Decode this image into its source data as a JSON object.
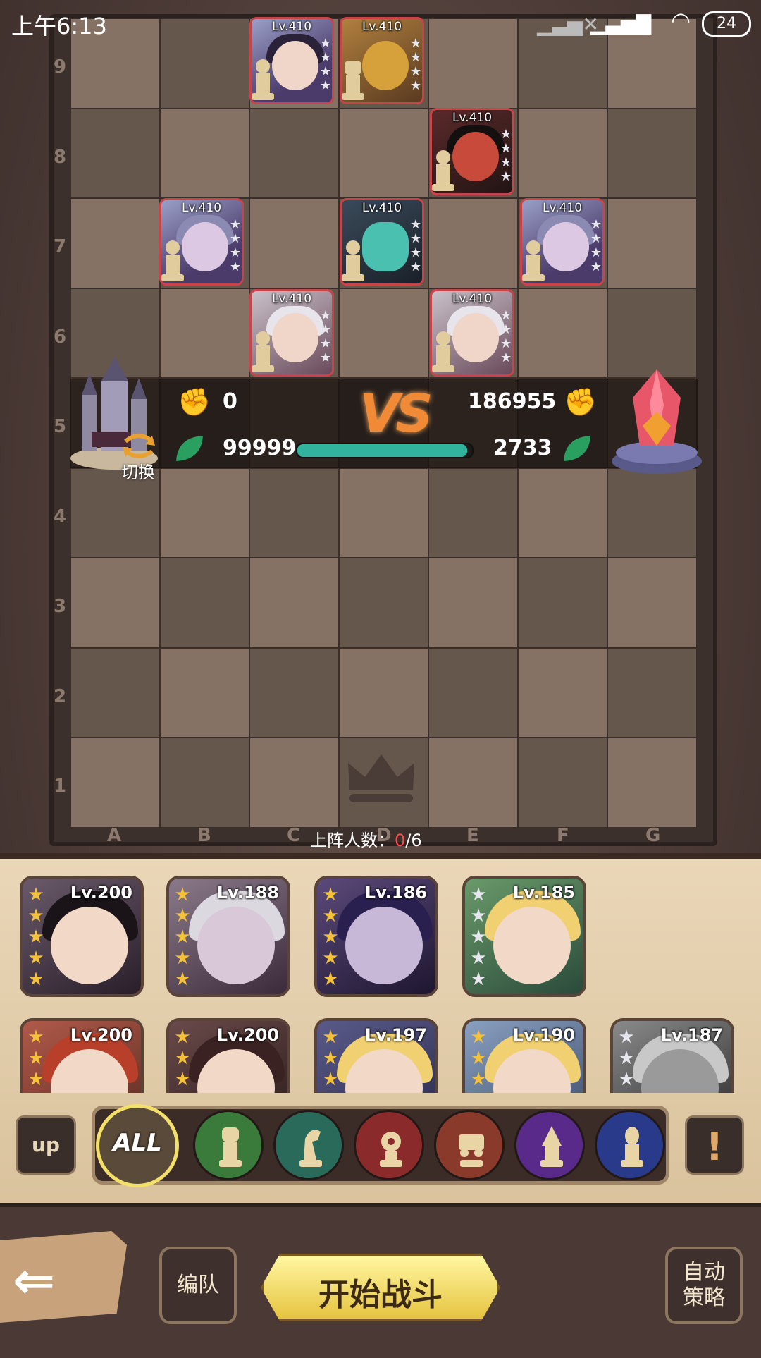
{
  "status_bar": {
    "time": "上午6:13",
    "battery": "24"
  },
  "board": {
    "ranks": [
      "9",
      "8",
      "7",
      "6",
      "5",
      "4",
      "3",
      "2",
      "1"
    ],
    "files": [
      "A",
      "B",
      "C",
      "D",
      "E",
      "F",
      "G"
    ]
  },
  "enemy_units": [
    {
      "level": "Lv.410"
    },
    {
      "level": "Lv.410"
    },
    {
      "level": "Lv.410"
    },
    {
      "level": "Lv.410"
    },
    {
      "level": "Lv.410"
    },
    {
      "level": "Lv.410"
    },
    {
      "level": "Lv.410"
    },
    {
      "level": "Lv.410"
    }
  ],
  "versus": {
    "vs_label": "VS",
    "player_attack": "0",
    "player_power": "99999",
    "enemy_attack": "186955",
    "enemy_power": "2733",
    "switch_label": "切换",
    "hp_fraction": 0.97
  },
  "deploy": {
    "label": "上阵人数：",
    "current": "0",
    "max": "/6"
  },
  "heroes": [
    {
      "level": "Lv.200",
      "stars": "★★★★★",
      "star_color": "#f3c13a"
    },
    {
      "level": "Lv.188",
      "stars": "★★★★★",
      "star_color": "#f3c13a"
    },
    {
      "level": "Lv.186",
      "stars": "★★★★★",
      "star_color": "#f3c13a"
    },
    {
      "level": "Lv.185",
      "stars": "★★★★★",
      "star_color": "#e6e6ee"
    },
    {
      "level": "Lv.200",
      "stars": "★★★",
      "star_color": "#f3c13a"
    },
    {
      "level": "Lv.200",
      "stars": "★★★",
      "star_color": "#f3c13a"
    },
    {
      "level": "Lv.197",
      "stars": "★★★",
      "star_color": "#f3c13a"
    },
    {
      "level": "Lv.190",
      "stars": "★★★",
      "star_color": "#f3c13a"
    },
    {
      "level": "Lv.187",
      "stars": "★★★",
      "star_color": "#e6e6ee"
    }
  ],
  "filters": {
    "all_label": "ALL",
    "up_label": "up",
    "warn_label": "!",
    "classes": [
      "warrior-class-icon",
      "knight-class-icon",
      "cannon-class-icon",
      "siege-class-icon",
      "mage-class-icon",
      "support-class-icon"
    ]
  },
  "bottom": {
    "team_label": "编队",
    "start_label": "开始战斗",
    "auto_label_1": "自动",
    "auto_label_2": "策略"
  }
}
